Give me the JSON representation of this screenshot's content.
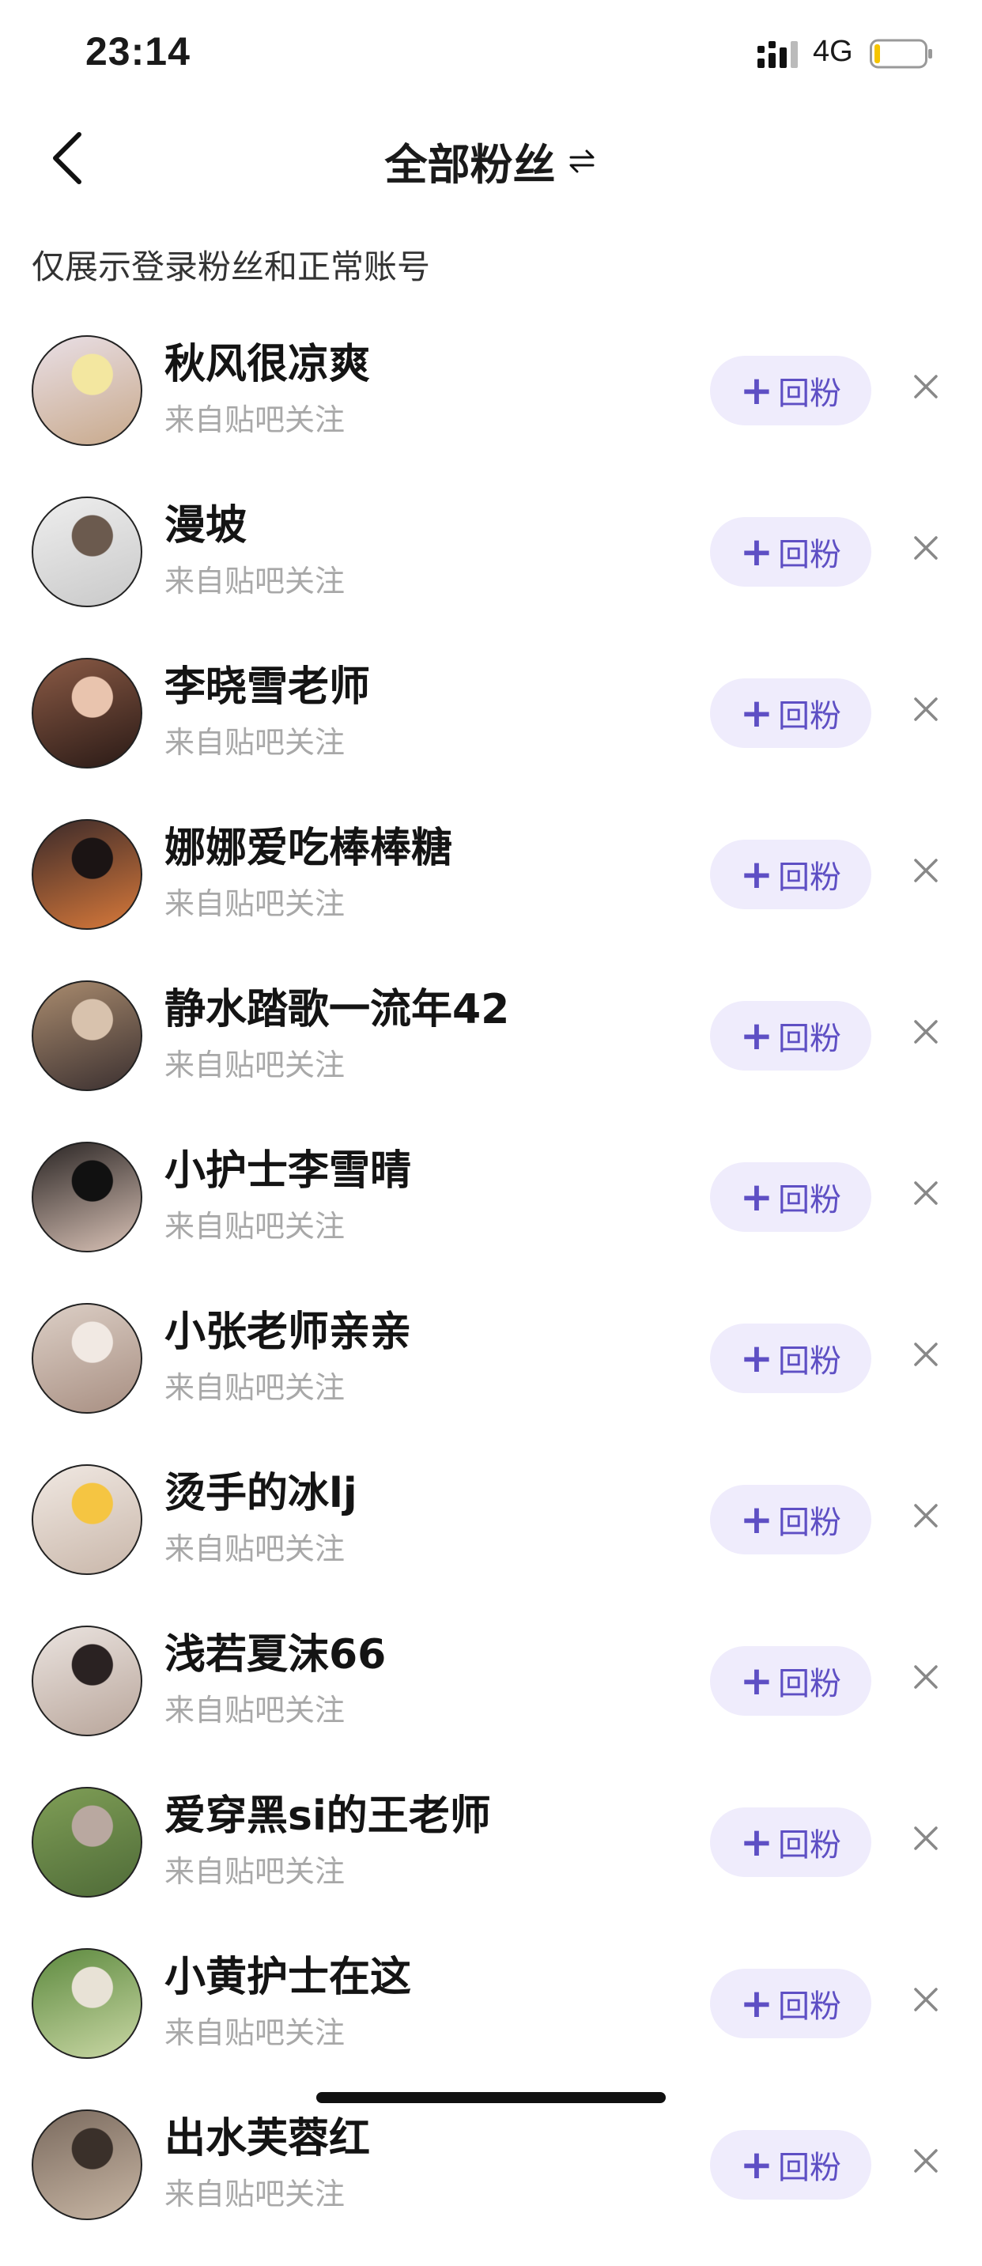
{
  "status_bar": {
    "time": "23:14",
    "network": "4G"
  },
  "nav": {
    "title": "全部粉丝"
  },
  "notice": "仅展示登录粉丝和正常账号",
  "button_labels": {
    "follow_back": "回粉"
  },
  "fans": [
    {
      "name": "秋风很凉爽",
      "source": "来自贴吧关注",
      "avatar_colors": [
        "#e9dfe6",
        "#c8a98b",
        "#f3e7a0"
      ]
    },
    {
      "name": "漫坡",
      "source": "来自贴吧关注",
      "avatar_colors": [
        "#eeeeee",
        "#c9c9c9",
        "#6b5a4e"
      ]
    },
    {
      "name": "李晓雪老师",
      "source": "来自贴吧关注",
      "avatar_colors": [
        "#8a5a45",
        "#2a1a16",
        "#e9c4ae"
      ]
    },
    {
      "name": "娜娜爱吃棒棒糖",
      "source": "来自贴吧关注",
      "avatar_colors": [
        "#3b2a2a",
        "#d8793a",
        "#1b1414"
      ]
    },
    {
      "name": "静水踏歌一流年42",
      "source": "来自贴吧关注",
      "avatar_colors": [
        "#a98b6e",
        "#3b3030",
        "#d8c2ad"
      ]
    },
    {
      "name": "小护士李雪晴",
      "source": "来自贴吧关注",
      "avatar_colors": [
        "#2a2524",
        "#d9c2b6",
        "#111111"
      ]
    },
    {
      "name": "小张老师亲亲",
      "source": "来自贴吧关注",
      "avatar_colors": [
        "#dccfc6",
        "#a88f82",
        "#f1e9e3"
      ]
    },
    {
      "name": "烫手的冰lj",
      "source": "来自贴吧关注",
      "avatar_colors": [
        "#f0e8e2",
        "#c9b7aa",
        "#f5c542"
      ]
    },
    {
      "name": "浅若夏沫66",
      "source": "来自贴吧关注",
      "avatar_colors": [
        "#eae3df",
        "#b9a69b",
        "#2a2222"
      ]
    },
    {
      "name": "爱穿黑si的王老师",
      "source": "来自贴吧关注",
      "avatar_colors": [
        "#7f9e56",
        "#4f6b38",
        "#b9a8a0"
      ]
    },
    {
      "name": "小黄护士在这",
      "source": "来自贴吧关注",
      "avatar_colors": [
        "#5d8a3f",
        "#c9d7a4",
        "#e8e2d6"
      ]
    },
    {
      "name": "出水芙蓉红",
      "source": "来自贴吧关注",
      "avatar_colors": [
        "#7a6a5e",
        "#c8b6a4",
        "#3a302a"
      ]
    }
  ]
}
